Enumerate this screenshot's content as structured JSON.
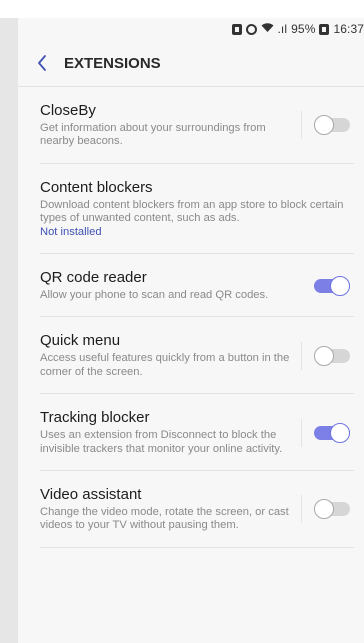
{
  "statusbar": {
    "signal_text": ".ıl",
    "battery": "95%",
    "time": "16:37"
  },
  "toolbar": {
    "back_icon": "chevron-left-icon",
    "title": "EXTENSIONS"
  },
  "colors": {
    "accent": "#7b7fe6",
    "link": "#3f51b5",
    "background": "#f7f7f7"
  },
  "items": [
    {
      "title": "CloseBy",
      "desc": "Get information about your surroundings from nearby beacons.",
      "status": "",
      "has_switch": true,
      "switch_on": false
    },
    {
      "title": "Content blockers",
      "desc": "Download content blockers from an app store to block certain types of unwanted content, such as ads.",
      "status": "Not installed",
      "has_switch": false,
      "switch_on": false
    },
    {
      "title": "QR code reader",
      "desc": "Allow your phone to scan and read QR codes.",
      "status": "",
      "has_switch": true,
      "switch_on": true
    },
    {
      "title": "Quick menu",
      "desc": "Access useful features quickly from a button in the corner of the screen.",
      "status": "",
      "has_switch": true,
      "switch_on": false
    },
    {
      "title": "Tracking blocker",
      "desc": "Uses an extension from Disconnect to block the invisible trackers that monitor your online activity.",
      "status": "",
      "has_switch": true,
      "switch_on": true
    },
    {
      "title": "Video assistant",
      "desc": "Change the video mode, rotate the screen, or cast videos to your TV without pausing them.",
      "status": "",
      "has_switch": true,
      "switch_on": false
    }
  ]
}
